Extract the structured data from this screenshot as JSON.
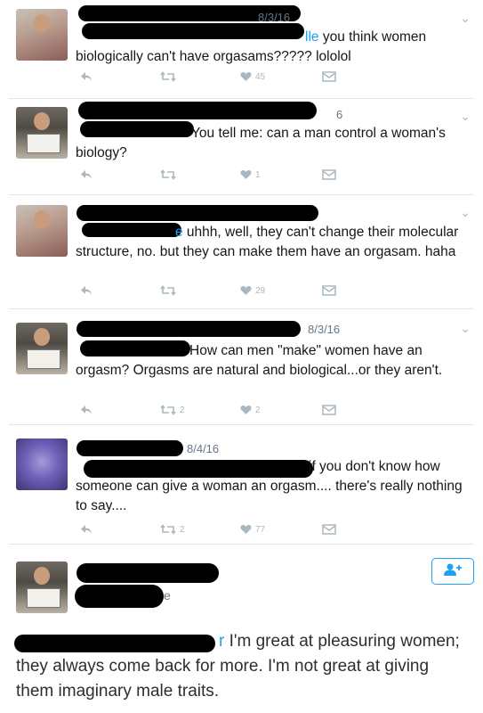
{
  "tweets": [
    {
      "date": "8/3/16",
      "mention_visible": "lle",
      "text": " you think women biologically can't have orgasams????? lololol",
      "replies": "",
      "retweets": "",
      "likes": "45"
    },
    {
      "date": "6",
      "mention_visible": "",
      "text": "You tell me: can a man control a woman's biology?",
      "replies": "",
      "retweets": "",
      "likes": "1"
    },
    {
      "date": "",
      "mention_visible": "e",
      "text": " uhhh, well, they can't change their molecular structure, no. but they can make them have an orgasam. haha",
      "replies": "",
      "retweets": "",
      "likes": "29"
    },
    {
      "date": "8/3/16",
      "mention_visible": "",
      "text": "How can men \"make\" women have an orgasm? Orgasms are natural and biological...or they aren't.",
      "replies": "",
      "retweets": "2",
      "likes": "2"
    },
    {
      "date": "8/4/16",
      "mention_visible": "",
      "text": "if you don't know how someone can give a woman an orgasm.... there's really nothing to say....",
      "replies": "",
      "retweets": "2",
      "likes": "77"
    }
  ],
  "final_tweet": {
    "handle_visible": "e",
    "mention_visible": "r",
    "text": " I'm great at pleasuring women; they always come back for more. I'm not great at giving them imaginary male traits."
  },
  "icons": {
    "reply": "reply-icon",
    "retweet": "retweet-icon",
    "like": "heart-icon",
    "dm": "envelope-icon",
    "caret": "chevron-down-icon",
    "follow": "follow-user-icon"
  },
  "colors": {
    "mention": "#1da1f2",
    "icon": "#aab8c2",
    "text": "#14171a"
  }
}
